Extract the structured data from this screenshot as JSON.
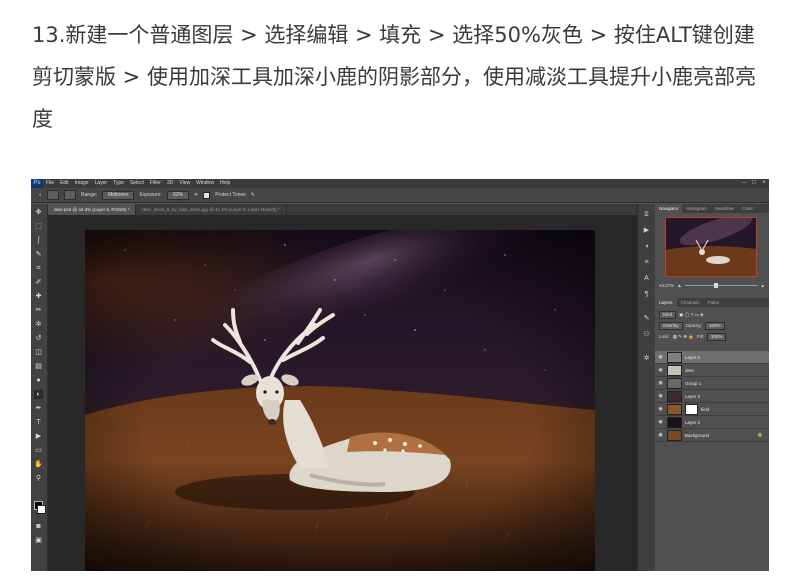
{
  "caption": {
    "lines": [
      "13.新建一个普通图层 > 选择编辑 > 填充 > 选择50%灰色 > 按住ALT键创建",
      "剪切蒙版 > 使用加深工具加深小鹿的阴影部分，使用减淡工具提升小鹿亮部亮",
      "度"
    ]
  },
  "app": {
    "logo": "Ps",
    "menu": [
      "File",
      "Edit",
      "Image",
      "Layer",
      "Type",
      "Select",
      "Filter",
      "3D",
      "View",
      "Window",
      "Help"
    ],
    "window_controls": [
      "–",
      "□",
      "×"
    ]
  },
  "options_bar": {
    "range_label": "Range:",
    "range_value": "Midtones",
    "exposure_label": "Exposure:",
    "exposure_value": "62%",
    "protect_tones": "Protect Tones"
  },
  "document_tabs": [
    {
      "label": "deer.psd @ 44.4% (Layer 5, RGB/8) *",
      "active": true
    },
    {
      "label": "deer_stock_5_by_faqs_stock.jpg @ 41.4% (Layer 0, Layer Mask/8) *",
      "active": false
    }
  ],
  "panels": {
    "top_tabs": [
      "Navigator",
      "Histogram",
      "Swatches",
      "Color"
    ],
    "zoom_value": "44.27%",
    "layer_tabs": [
      "Layers",
      "Channels",
      "Paths"
    ],
    "filter_kind": "Kind",
    "blend_mode": "Overlay",
    "opacity_label": "Opacity:",
    "opacity_value": "100%",
    "lock_label": "Lock:",
    "fill_label": "Fill:",
    "fill_value": "100%"
  },
  "layers": [
    {
      "name": "Layer 5",
      "selected": true,
      "thumb": "#808080",
      "mask": false
    },
    {
      "name": "deer",
      "selected": false,
      "thumb": "#c8c0b4",
      "mask": false
    },
    {
      "name": "Group 1",
      "selected": false,
      "thumb": "#6a6a6a",
      "mask": false
    },
    {
      "name": "Layer 3",
      "selected": false,
      "thumb": "#3b2c2a",
      "mask": false
    },
    {
      "name": "field",
      "selected": false,
      "thumb": "#8a5a2a",
      "mask": true
    },
    {
      "name": "Layer 2",
      "selected": false,
      "thumb": "#1a1420",
      "mask": false
    },
    {
      "name": "Background",
      "selected": false,
      "thumb": "#7a4a22",
      "mask": false
    }
  ],
  "tools": [
    "move-icon",
    "marquee-icon",
    "lasso-icon",
    "quick-select-icon",
    "crop-icon",
    "eyedropper-icon",
    "healing-icon",
    "brush-icon",
    "clone-stamp-icon",
    "history-brush-icon",
    "eraser-icon",
    "gradient-icon",
    "blur-icon",
    "dodge-icon",
    "pen-icon",
    "type-icon",
    "path-select-icon",
    "shape-icon",
    "hand-icon",
    "zoom-icon"
  ],
  "tool_glyphs": [
    "✥",
    "⬚",
    "ʃ",
    "✎",
    "⌗",
    "✐",
    "✚",
    "✏",
    "✲",
    "↺",
    "◫",
    "▤",
    "●",
    "◐",
    "✒",
    "T",
    "▶",
    "▭",
    "✋",
    "⚲"
  ],
  "colors": {
    "foreground": "#000000",
    "background": "#ffffff",
    "accent": "#c43a2a"
  }
}
